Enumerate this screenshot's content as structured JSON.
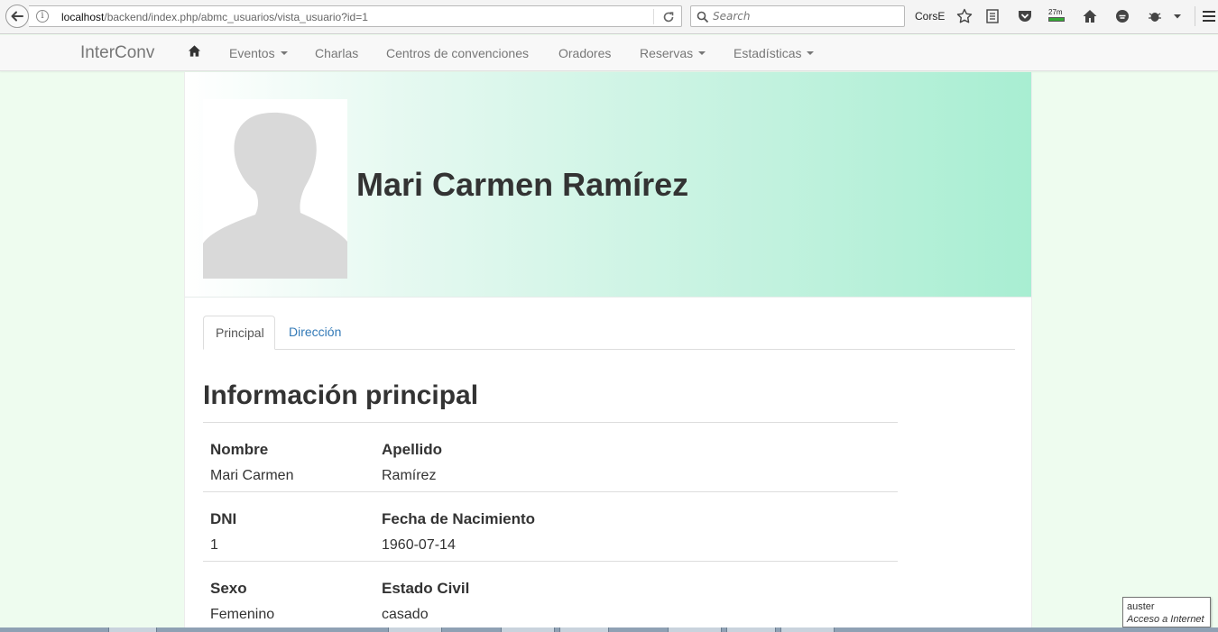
{
  "browser": {
    "url_host": "localhost",
    "url_path": "/backend/index.php/abmc_usuarios/vista_usuario?id=1",
    "search_placeholder": "Search",
    "extension_label": "CorsE",
    "badge_text": "27m"
  },
  "navbar": {
    "brand": "InterConv",
    "items": [
      {
        "label": "Eventos",
        "dropdown": true
      },
      {
        "label": "Charlas",
        "dropdown": false
      },
      {
        "label": "Centros de convenciones",
        "dropdown": false
      },
      {
        "label": "Oradores",
        "dropdown": false
      },
      {
        "label": "Reservas",
        "dropdown": true
      },
      {
        "label": "Estadísticas",
        "dropdown": true
      }
    ]
  },
  "profile": {
    "full_name": "Mari Carmen Ramírez"
  },
  "tabs": {
    "principal": "Principal",
    "direccion": "Dirección"
  },
  "section": {
    "title": "Información principal"
  },
  "info": {
    "rows": [
      {
        "label1": "Nombre",
        "value1": "Mari Carmen",
        "label2": "Apellido",
        "value2": "Ramírez"
      },
      {
        "label1": "DNI",
        "value1": "1",
        "label2": "Fecha de Nacimiento",
        "value2": "1960-07-14"
      },
      {
        "label1": "Sexo",
        "value1": "Femenino",
        "label2": "Estado Civil",
        "value2": "casado"
      }
    ]
  },
  "tooltip": {
    "title": "auster",
    "subtitle": "Acceso a Internet"
  },
  "colors": {
    "jumbotron_end": "#a8eed2",
    "link": "#337ab7",
    "page_background": "#eefcef"
  }
}
